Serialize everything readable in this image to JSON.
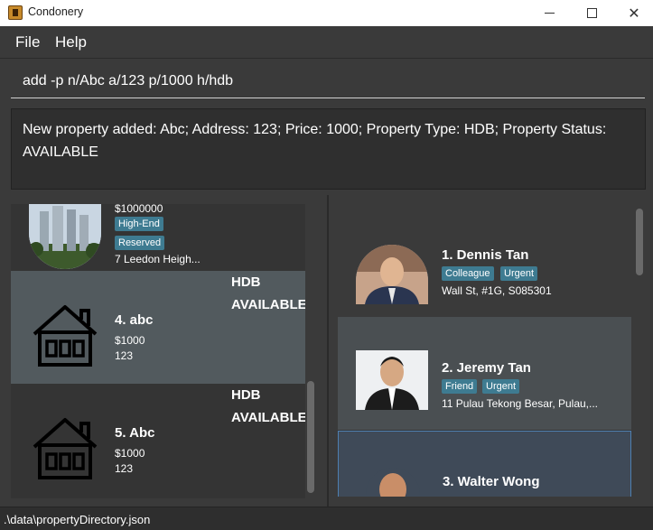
{
  "window": {
    "title": "Condonery",
    "minimize_icon": "minimize-icon",
    "maximize_icon": "maximize-icon",
    "close_icon": "close-icon",
    "close_glyph": "✕"
  },
  "menu": {
    "file": "File",
    "help": "Help"
  },
  "command": {
    "value": "add -p n/Abc a/123 p/1000 h/hdb"
  },
  "result": {
    "text": "New property added: Abc; Address: 123; Price: 1000; Property Type: HDB; Property Status: AVAILABLE"
  },
  "properties": [
    {
      "name": "",
      "price": "$1000000",
      "tags": [
        "High-End",
        "Reserved"
      ],
      "address": "7 Leedon Heigh...",
      "type": "",
      "status": "",
      "icon": "condo-photo"
    },
    {
      "name": "4.  abc",
      "price": "$1000",
      "address": "123",
      "type": "HDB",
      "status": "AVAILABLE",
      "icon": "house-icon"
    },
    {
      "name": "5.  Abc",
      "price": "$1000",
      "address": "123",
      "type": "HDB",
      "status": "AVAILABLE",
      "icon": "house-icon"
    }
  ],
  "clients": [
    {
      "name": "1.  Dennis Tan",
      "tags": [
        "Colleague",
        "Urgent"
      ],
      "address": "Wall St, #1G, S085301"
    },
    {
      "name": "2.  Jeremy Tan",
      "tags": [
        "Friend",
        "Urgent"
      ],
      "address": "11 Pulau Tekong Besar, Pulau,..."
    },
    {
      "name": "3.  Walter Wong",
      "tags": [],
      "address": ""
    }
  ],
  "status_bar": {
    "path": ".\\data\\propertyDirectory.json"
  }
}
